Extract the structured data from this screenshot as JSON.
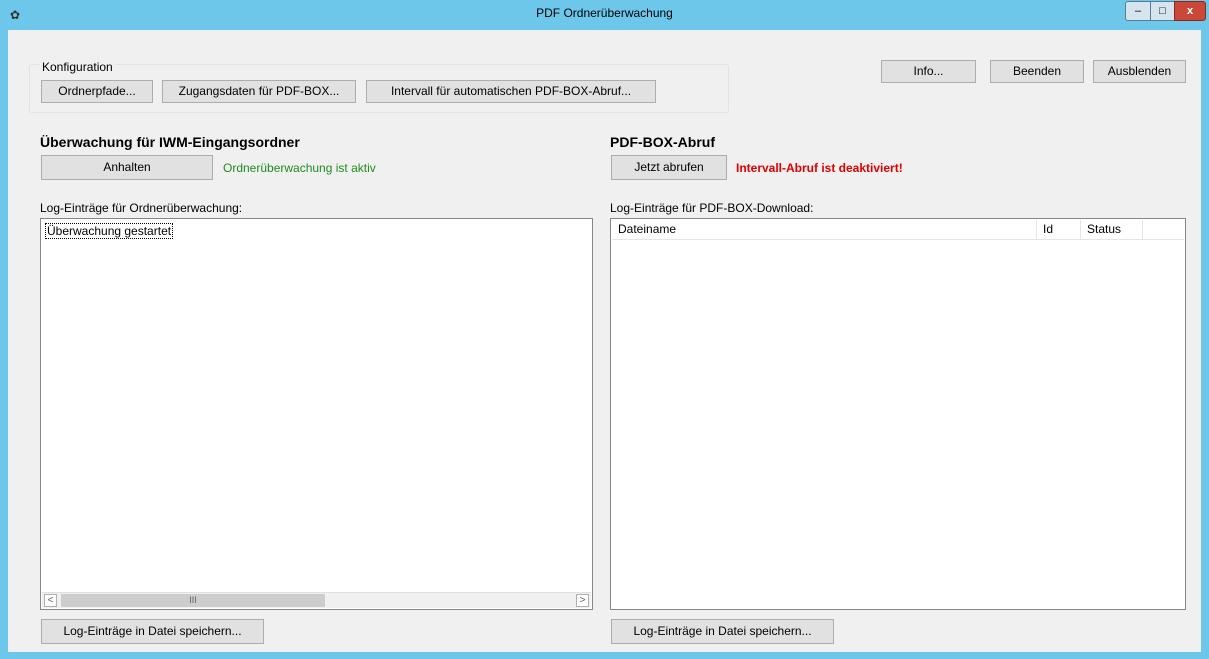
{
  "window": {
    "title": "PDF Ordnerüberwachung",
    "controls": {
      "minimize": "–",
      "maximize": "□",
      "close": "x"
    },
    "icon": "app-icon"
  },
  "config": {
    "group_label": "Konfiguration",
    "buttons": {
      "paths": "Ordnerpfade...",
      "credentials": "Zugangsdaten für PDF-BOX...",
      "interval": "Intervall für automatischen PDF-BOX-Abruf..."
    }
  },
  "top_buttons": {
    "info": "Info...",
    "quit": "Beenden",
    "hide": "Ausblenden"
  },
  "folder_watch": {
    "heading": "Überwachung für IWM-Eingangsordner",
    "stop_button": "Anhalten",
    "status": "Ordnerüberwachung ist aktiv",
    "status_color": "#1f8c1f",
    "log_label": "Log-Einträge für Ordnerüberwachung:",
    "log_entries": [
      "Überwachung gestartet"
    ],
    "save_button": "Log-Einträge in Datei speichern...",
    "scroll_grip": "III"
  },
  "pdfbox": {
    "heading": "PDF-BOX-Abruf",
    "fetch_button": "Jetzt abrufen",
    "status": "Intervall-Abruf ist deaktiviert!",
    "status_color": "#e00000",
    "log_label": "Log-Einträge für PDF-BOX-Download:",
    "columns": {
      "filename": "Dateiname",
      "id": "Id",
      "status": "Status"
    },
    "save_button": "Log-Einträge in Datei speichern..."
  }
}
